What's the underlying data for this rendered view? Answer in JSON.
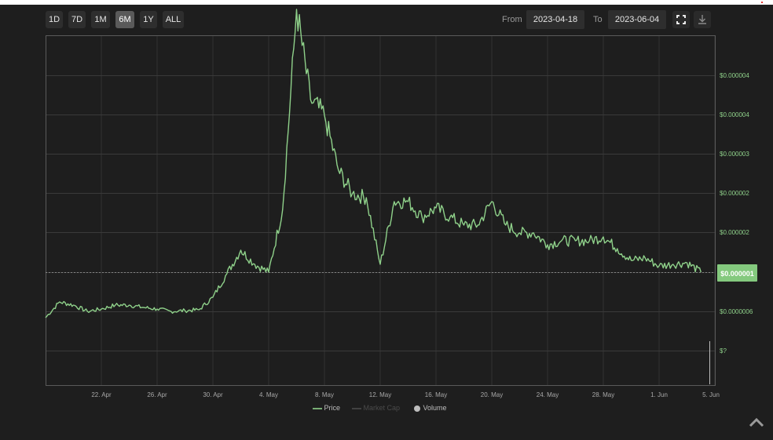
{
  "toolbar": {
    "ranges": [
      "1D",
      "7D",
      "1M",
      "6M",
      "1Y",
      "ALL"
    ],
    "active_range": "6M",
    "from_label": "From",
    "from_value": "2023-04-18",
    "to_label": "To",
    "to_value": "2023-06-04"
  },
  "icons": {
    "fullscreen": "fullscreen-icon",
    "download": "download-icon",
    "scroll_top": "chevron-up-icon"
  },
  "colors": {
    "background": "#1e1e1e",
    "price_line": "#8fd18a",
    "current_price_badge": "#84c97e",
    "grid": "#3a3a3a"
  },
  "legend": [
    {
      "name": "Price",
      "enabled": true
    },
    {
      "name": "Market Cap",
      "enabled": false
    },
    {
      "name": "Volume",
      "enabled": true
    }
  ],
  "current_price_label": "$0.000001",
  "chart_data": {
    "type": "line",
    "x_tick_labels": [
      "22. Apr",
      "26. Apr",
      "30. Apr",
      "4. May",
      "8. May",
      "12. May",
      "16. May",
      "20. May",
      "24. May",
      "28. May",
      "1. Jun",
      "5. Jun"
    ],
    "y_tick_labels": [
      "$0.000004",
      "$0.000004",
      "$0.000003",
      "$0.000002",
      "$0.000002",
      "$0.000001",
      "$0.0000006",
      "$?"
    ],
    "x_range": [
      "2023-04-18",
      "2023-06-04"
    ],
    "grid": true,
    "legend_position": "bottom-center",
    "series": [
      {
        "name": "Price",
        "x": [
          "2023-04-18",
          "2023-04-19",
          "2023-04-20",
          "2023-04-21",
          "2023-04-22",
          "2023-04-23",
          "2023-04-24",
          "2023-04-25",
          "2023-04-26",
          "2023-04-27",
          "2023-04-28",
          "2023-04-29",
          "2023-04-30",
          "2023-05-01",
          "2023-05-02",
          "2023-05-03",
          "2023-05-04",
          "2023-05-05",
          "2023-05-06",
          "2023-05-07",
          "2023-05-08",
          "2023-05-09",
          "2023-05-10",
          "2023-05-11",
          "2023-05-12",
          "2023-05-13",
          "2023-05-14",
          "2023-05-15",
          "2023-05-16",
          "2023-05-17",
          "2023-05-18",
          "2023-05-19",
          "2023-05-20",
          "2023-05-21",
          "2023-05-22",
          "2023-05-23",
          "2023-05-24",
          "2023-05-25",
          "2023-05-26",
          "2023-05-27",
          "2023-05-28",
          "2023-05-29",
          "2023-05-30",
          "2023-05-31",
          "2023-06-01",
          "2023-06-02",
          "2023-06-03",
          "2023-06-04"
        ],
        "values": [
          4.2e-07,
          6.2e-07,
          5.8e-07,
          5e-07,
          5.3e-07,
          5.8e-07,
          5.8e-07,
          5.5e-07,
          5.3e-07,
          5e-07,
          5.1e-07,
          5.2e-07,
          6.8e-07,
          9.8e-07,
          1.28e-06,
          1.1e-06,
          1e-06,
          1.8e-06,
          4.35e-06,
          3.2e-06,
          3e-06,
          2.3e-06,
          2e-06,
          1.95e-06,
          1.1e-06,
          1.9e-06,
          1.9e-06,
          1.7e-06,
          1.82e-06,
          1.7e-06,
          1.6e-06,
          1.6e-06,
          1.9e-06,
          1.6e-06,
          1.5e-06,
          1.5e-06,
          1.35e-06,
          1.4e-06,
          1.4e-06,
          1.4e-06,
          1.45e-06,
          1.3e-06,
          1.15e-06,
          1.18e-06,
          1.08e-06,
          1.1e-06,
          1.12e-06,
          1e-06
        ]
      }
    ]
  }
}
